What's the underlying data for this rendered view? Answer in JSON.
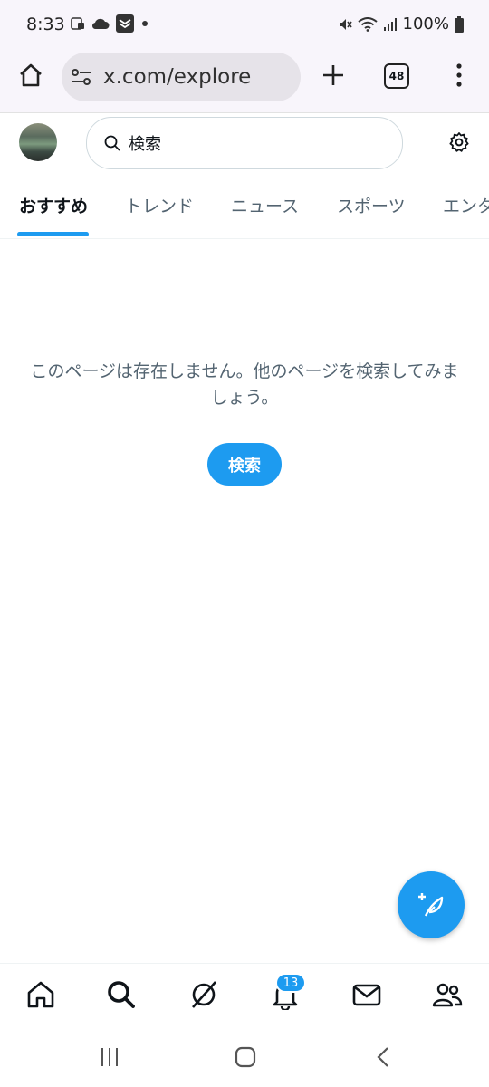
{
  "status_bar": {
    "time": "8:33",
    "battery": "100%",
    "icons": [
      "screenshot-icon",
      "cloud-icon",
      "app-icon",
      "dot-icon",
      "mute-icon",
      "wifi-icon",
      "signal-icon",
      "battery-icon"
    ]
  },
  "browser": {
    "url": "x.com/explore",
    "tab_count": "48",
    "icons": [
      "home-icon",
      "site-settings-icon",
      "new-tab-icon",
      "tab-switcher-icon",
      "menu-icon"
    ]
  },
  "header": {
    "search_placeholder": "検索",
    "icons": [
      "avatar",
      "search-icon",
      "settings-icon"
    ]
  },
  "tabs": [
    {
      "label": "おすすめ",
      "active": true
    },
    {
      "label": "トレンド",
      "active": false
    },
    {
      "label": "ニュース",
      "active": false
    },
    {
      "label": "スポーツ",
      "active": false
    },
    {
      "label": "エンタ",
      "active": false
    }
  ],
  "empty_state": {
    "message": "このページは存在しません。他のページを検索してみましょう。",
    "button_label": "検索"
  },
  "bottom_nav": {
    "notification_count": "13",
    "items": [
      "home-icon",
      "search-icon",
      "grok-icon",
      "notifications-icon",
      "messages-icon",
      "communities-icon"
    ]
  },
  "colors": {
    "accent": "#1d9bf0",
    "text_primary": "#0f1419",
    "text_secondary": "#536471",
    "browser_bg": "#f8f5fb"
  }
}
